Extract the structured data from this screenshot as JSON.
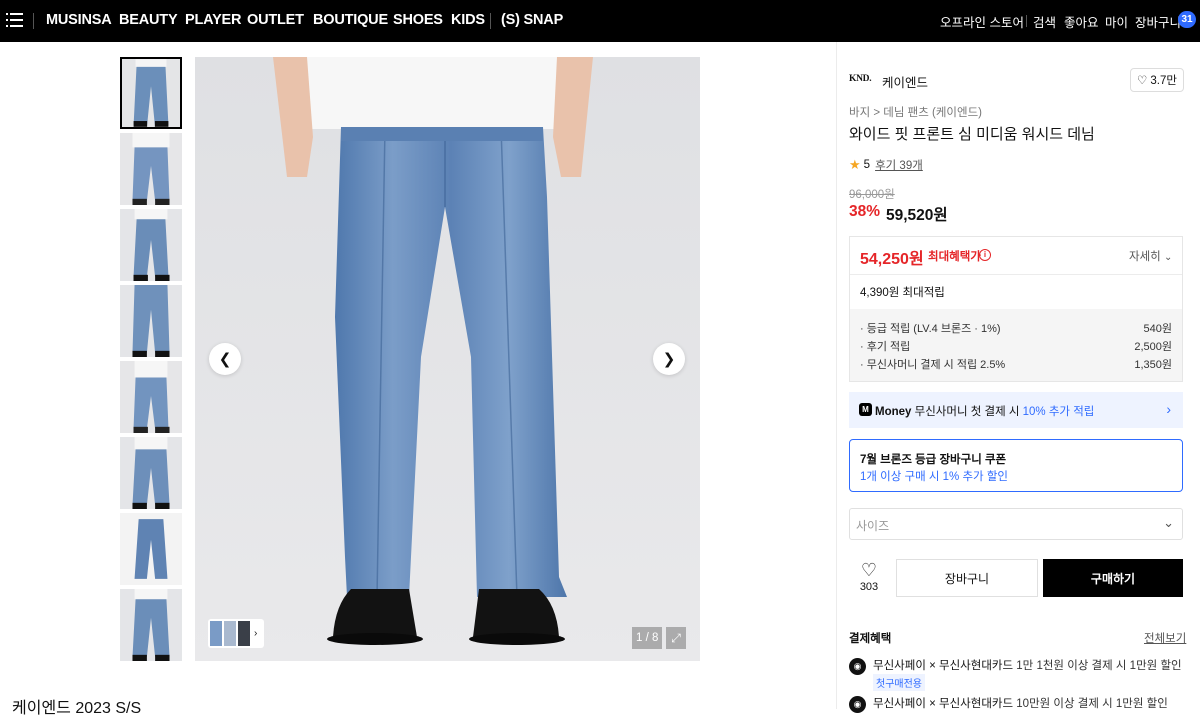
{
  "nav": {
    "items": [
      "MUSINSA",
      "BEAUTY",
      "PLAYER",
      "OUTLET",
      "BOUTIQUE",
      "SHOES",
      "KIDS"
    ],
    "snap": "(S) SNAP",
    "right": [
      "오프라인 스토어",
      "검색",
      "좋아요",
      "마이",
      "장바구니"
    ],
    "cart_count": "31"
  },
  "gallery": {
    "counter": "1 / 8",
    "section_title": "케이엔드 2023 S/S"
  },
  "product": {
    "brand_logo": "KND.",
    "brand_name": "케이엔드",
    "likes": "3.7만",
    "breadcrumb": [
      "바지",
      "데님 팬츠 (케이엔드)"
    ],
    "title": "와이드 핏 프론트 심 미디움 워시드 데님",
    "rating": "5",
    "reviews": "후기 39개",
    "original_price": "96,000원",
    "discount": "38%",
    "price": "59,520원"
  },
  "benefit": {
    "max_price": "54,250원",
    "max_label": "최대혜택가",
    "detail": "자세히",
    "points_total": "4,390원 최대적립",
    "points": [
      {
        "label": "· 등급 적립 (LV.4 브론즈 · 1%)",
        "value": "540원"
      },
      {
        "label": "· 후기 적립",
        "value": "2,500원"
      },
      {
        "label": "· 무신사머니 결제 시 적립 2.5%",
        "value": "1,350원"
      }
    ]
  },
  "money": {
    "logo": "M",
    "brand": "Money",
    "text": "무신사머니 첫 결제 시",
    "highlight": "10% 추가 적립"
  },
  "coupon": {
    "title": "7월 브론즈 등급 장바구니 쿠폰",
    "sub": "1개 이상 구매 시 1% 추가 할인"
  },
  "size": {
    "placeholder": "사이즈"
  },
  "actions": {
    "wish_count": "303",
    "cart": "장바구니",
    "buy": "구매하기"
  },
  "payment": {
    "title": "결제혜택",
    "all": "전체보기",
    "rows": [
      {
        "name": "무신사페이 × 무신사현대카드",
        "desc": "1만 1천원 이상 결제 시 1만원 할인",
        "tag": "첫구매전용"
      },
      {
        "name": "무신사페이 × 무신사현대카드",
        "desc": "10만원 이상 결제 시 1만원 할인",
        "tag": ""
      }
    ]
  },
  "colors": {
    "accent": "#e52528",
    "blue": "#2f6bff",
    "nav_bg": "#000000"
  }
}
